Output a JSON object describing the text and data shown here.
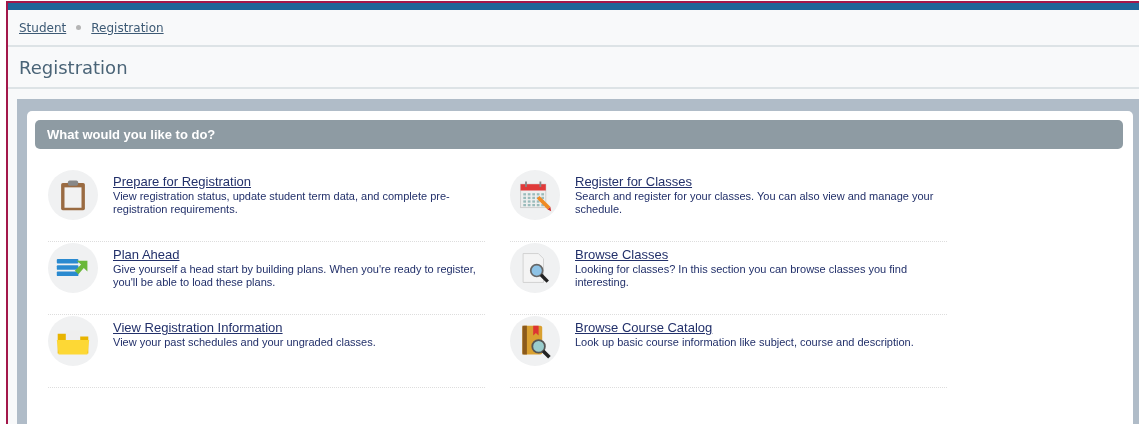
{
  "breadcrumb": [
    {
      "label": "Student"
    },
    {
      "label": "Registration"
    }
  ],
  "page_title": "Registration",
  "panel": {
    "heading": "What would you like to do?",
    "actions": [
      {
        "title": "Prepare for Registration",
        "description": "View registration status, update student term data, and complete pre-registration requirements."
      },
      {
        "title": "Register for Classes",
        "description": "Search and register for your classes. You can also view and manage your schedule."
      },
      {
        "title": "Plan Ahead",
        "description": "Give yourself a head start by building plans. When you're ready to register, you'll be able to load these plans."
      },
      {
        "title": "Browse Classes",
        "description": "Looking for classes? In this section you can browse classes you find interesting."
      },
      {
        "title": "View Registration Information",
        "description": "View your past schedules and your ungraded classes."
      },
      {
        "title": "Browse Course Catalog",
        "description": "Look up basic course information like subject, course and description."
      }
    ]
  }
}
